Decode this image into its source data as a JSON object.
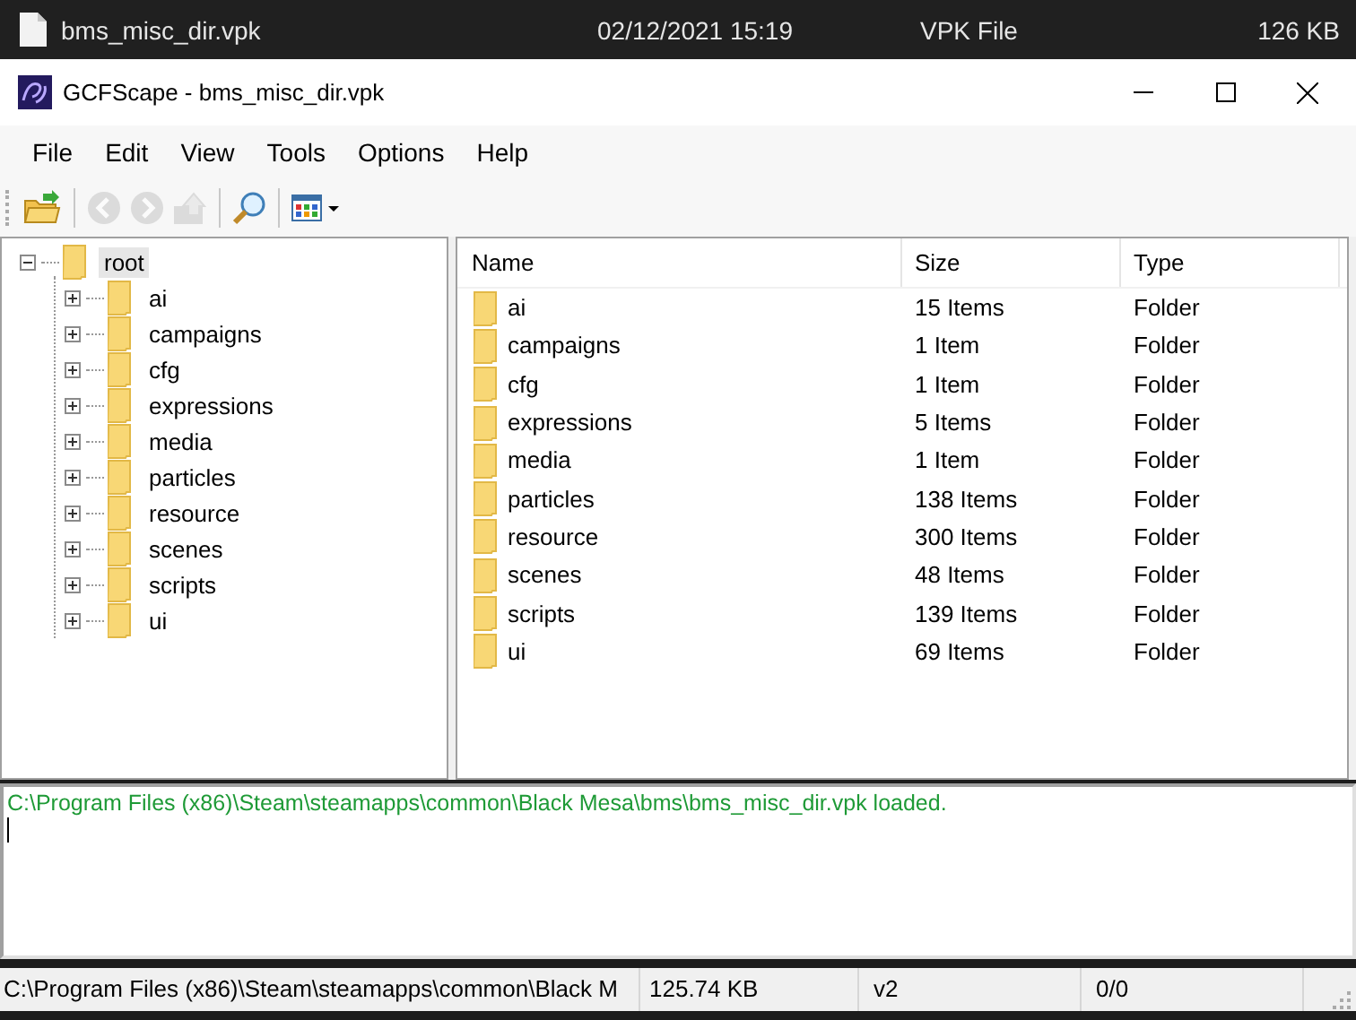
{
  "explorer_row": {
    "name": "bms_misc_dir.vpk",
    "date_modified": "02/12/2021 15:19",
    "type": "VPK File",
    "size": "126 KB"
  },
  "window": {
    "title": "GCFScape - bms_misc_dir.vpk"
  },
  "menu": [
    "File",
    "Edit",
    "View",
    "Tools",
    "Options",
    "Help"
  ],
  "toolbar": [
    {
      "kind": "open",
      "disabled": false
    },
    {
      "kind": "separator"
    },
    {
      "kind": "back",
      "disabled": true
    },
    {
      "kind": "forward",
      "disabled": true
    },
    {
      "kind": "up",
      "disabled": true
    },
    {
      "kind": "separator"
    },
    {
      "kind": "search",
      "disabled": false
    },
    {
      "kind": "separator"
    },
    {
      "kind": "view",
      "disabled": false
    }
  ],
  "tree": {
    "label": "root",
    "expanded": true,
    "selected": true,
    "children": [
      {
        "label": "ai",
        "expanded": false,
        "selected": false
      },
      {
        "label": "campaigns",
        "expanded": false,
        "selected": false
      },
      {
        "label": "cfg",
        "expanded": false,
        "selected": false
      },
      {
        "label": "expressions",
        "expanded": false,
        "selected": false
      },
      {
        "label": "media",
        "expanded": false,
        "selected": false
      },
      {
        "label": "particles",
        "expanded": false,
        "selected": false
      },
      {
        "label": "resource",
        "expanded": false,
        "selected": false
      },
      {
        "label": "scenes",
        "expanded": false,
        "selected": false
      },
      {
        "label": "scripts",
        "expanded": false,
        "selected": false
      },
      {
        "label": "ui",
        "expanded": false,
        "selected": false
      }
    ]
  },
  "list": {
    "columns": [
      "Name",
      "Size",
      "Type"
    ],
    "rows": [
      {
        "name": "ai",
        "size": "15 Items",
        "type": "Folder"
      },
      {
        "name": "campaigns",
        "size": "1 Item",
        "type": "Folder"
      },
      {
        "name": "cfg",
        "size": "1 Item",
        "type": "Folder"
      },
      {
        "name": "expressions",
        "size": "5 Items",
        "type": "Folder"
      },
      {
        "name": "media",
        "size": "1 Item",
        "type": "Folder"
      },
      {
        "name": "particles",
        "size": "138 Items",
        "type": "Folder"
      },
      {
        "name": "resource",
        "size": "300 Items",
        "type": "Folder"
      },
      {
        "name": "scenes",
        "size": "48 Items",
        "type": "Folder"
      },
      {
        "name": "scripts",
        "size": "139 Items",
        "type": "Folder"
      },
      {
        "name": "ui",
        "size": "69 Items",
        "type": "Folder"
      }
    ]
  },
  "log": {
    "text": "C:\\Program Files (x86)\\Steam\\steamapps\\common\\Black Mesa\\bms\\bms_misc_dir.vpk loaded."
  },
  "status_bar": [
    "C:\\Program Files (x86)\\Steam\\steamapps\\common\\Black M",
    "125.74 KB",
    "v2",
    "0/0"
  ]
}
